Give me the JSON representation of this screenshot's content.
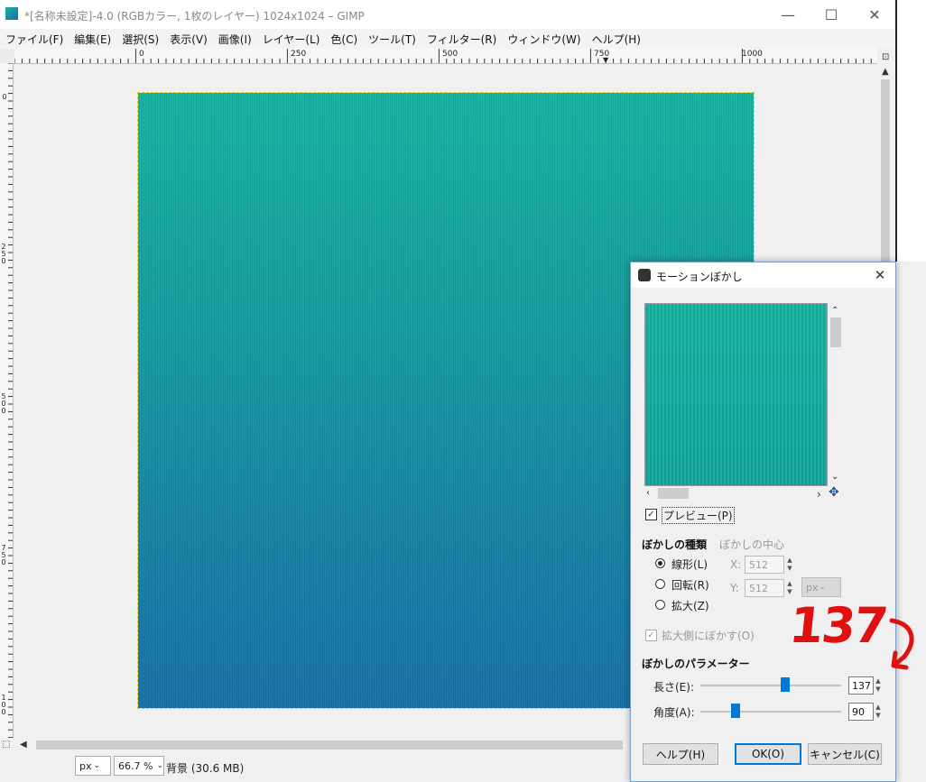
{
  "window": {
    "title": "*[名称未設定]-4.0 (RGBカラー, 1枚のレイヤー) 1024x1024 – GIMP",
    "minimize": "—",
    "maximize": "☐",
    "close": "✕"
  },
  "menubar": {
    "items": [
      "ファイル(F)",
      "編集(E)",
      "選択(S)",
      "表示(V)",
      "画像(I)",
      "レイヤー(L)",
      "色(C)",
      "ツール(T)",
      "フィルター(R)",
      "ウィンドウ(W)",
      "ヘルプ(H)"
    ]
  },
  "ruler": {
    "h_labels": [
      "0",
      "250",
      "500",
      "750",
      "1000"
    ],
    "v_labels": [
      "0",
      "250",
      "500",
      "750",
      "100"
    ]
  },
  "statusbar": {
    "unit": "px",
    "zoom": "66.7 %",
    "layer_info": "背景 (30.6 MB)"
  },
  "dialog": {
    "title": "モーションぼかし",
    "close": "✕",
    "preview_label": "プレビュー(P)",
    "preview_checked": true,
    "blur_type_title": "ぼかしの種類",
    "blur_center_title": "ぼかしの中心",
    "blur_types": [
      {
        "label": "線形(L)",
        "selected": true
      },
      {
        "label": "回転(R)",
        "selected": false
      },
      {
        "label": "拡大(Z)",
        "selected": false
      }
    ],
    "center_x_label": "X:",
    "center_x": "512",
    "center_y_label": "Y:",
    "center_y": "512",
    "center_unit": "px",
    "blur_outward_label": "拡大側にぼかす(O)",
    "params_title": "ぼかしのパラメーター",
    "length_label": "長さ(E):",
    "length_value": "137",
    "length_fraction": 0.6,
    "angle_label": "角度(A):",
    "angle_value": "90",
    "angle_fraction": 0.25,
    "help_button": "ヘルプ(H)",
    "ok_button": "OK(O)",
    "cancel_button": "キャンセル(C)"
  },
  "annotation": {
    "text": "137"
  },
  "colors": {
    "accent": "#0078d7",
    "annotation": "#e01010",
    "canvas_top": "#14b3a0",
    "canvas_bottom": "#1670a6"
  }
}
